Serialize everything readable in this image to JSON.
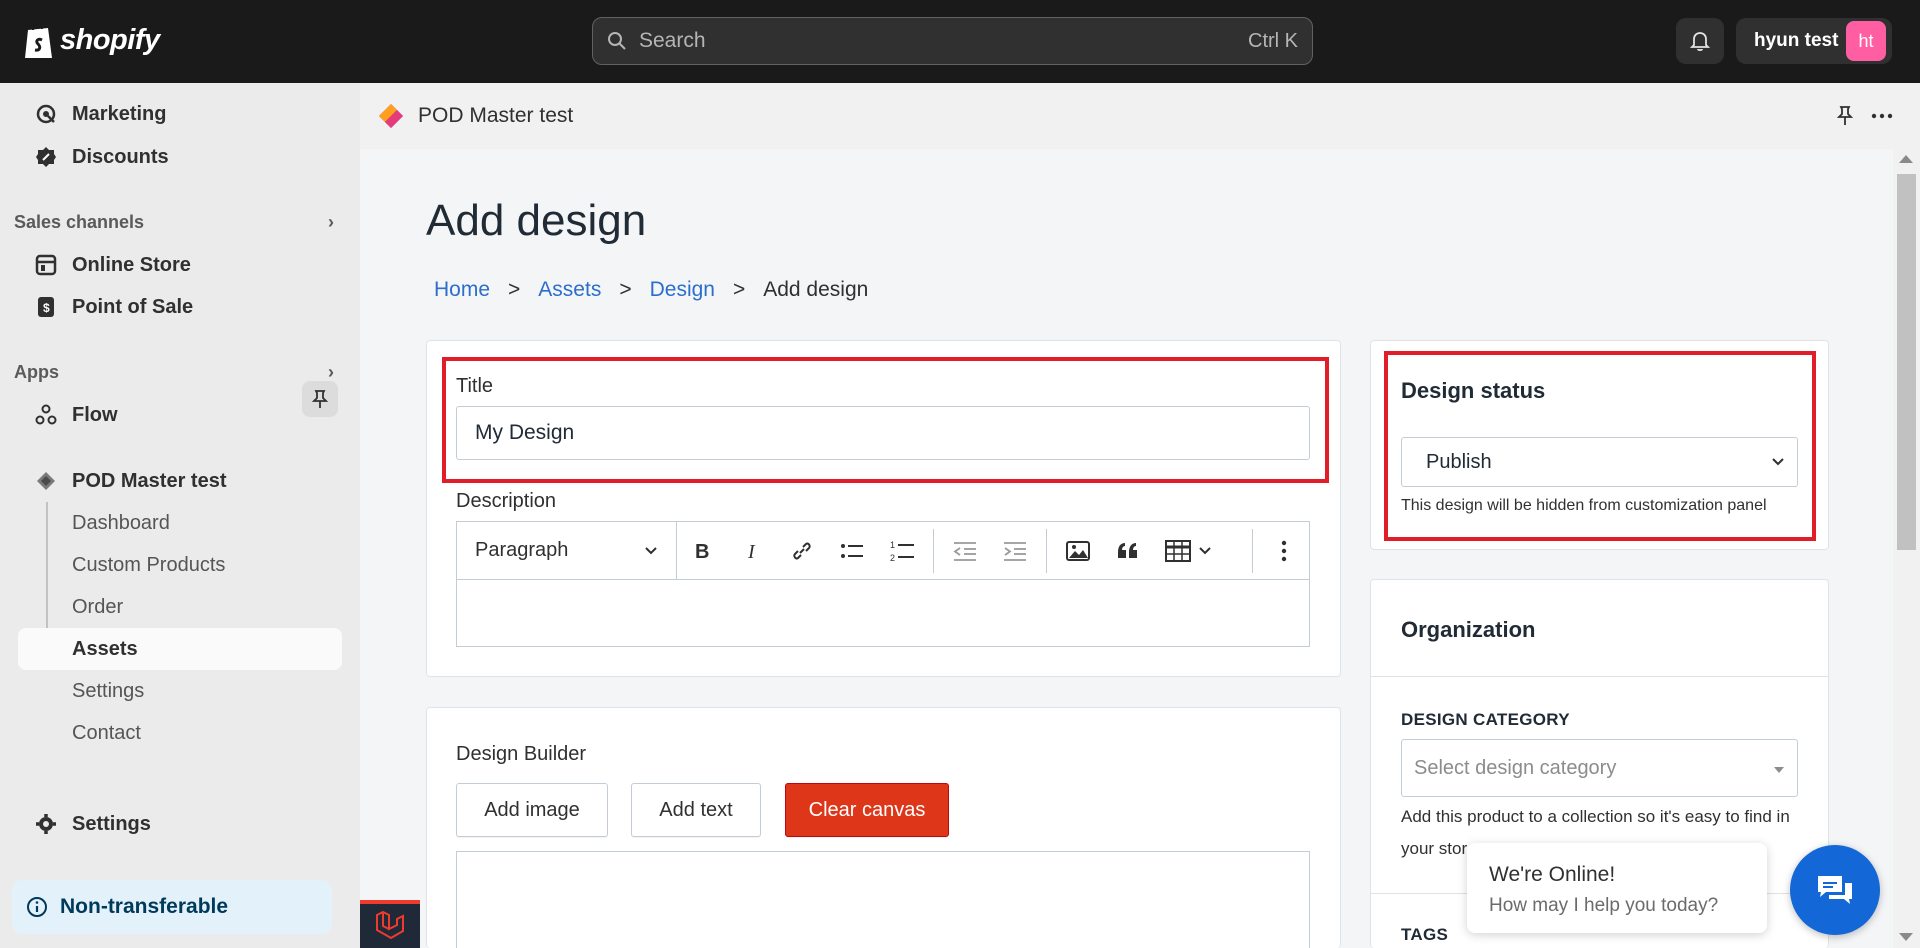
{
  "topbar": {
    "brand": "shopify",
    "search_placeholder": "Search",
    "search_shortcut": "Ctrl K",
    "user_name": "hyun test",
    "user_initials": "ht"
  },
  "sidebar": {
    "items_top": [
      {
        "label": "Marketing",
        "icon": "marketing-icon"
      },
      {
        "label": "Discounts",
        "icon": "discount-icon"
      }
    ],
    "sales_channels_heading": "Sales channels",
    "sales_channels": [
      {
        "label": "Online Store",
        "icon": "store-icon"
      },
      {
        "label": "Point of Sale",
        "icon": "pos-icon"
      }
    ],
    "apps_heading": "Apps",
    "apps": [
      {
        "label": "Flow",
        "icon": "flow-icon"
      },
      {
        "label": "POD Master test",
        "icon": "app-icon"
      }
    ],
    "app_sub_items": [
      "Dashboard",
      "Custom Products",
      "Order",
      "Assets",
      "Settings",
      "Contact"
    ],
    "active_sub_item": "Assets",
    "settings_label": "Settings",
    "non_transferable_label": "Non-transferable"
  },
  "app_header": {
    "title": "POD Master test"
  },
  "page": {
    "title": "Add design",
    "breadcrumb": {
      "home": "Home",
      "assets": "Assets",
      "design": "Design",
      "current": "Add design",
      "separator": ">"
    },
    "title_field": {
      "label": "Title",
      "value": "My Design"
    },
    "description": {
      "label": "Description",
      "format_select": "Paragraph"
    },
    "design_builder": {
      "label": "Design Builder",
      "add_image": "Add image",
      "add_text": "Add text",
      "clear_canvas": "Clear canvas"
    },
    "design_status": {
      "title": "Design status",
      "selected": "Publish",
      "help": "This design will be hidden from customization panel"
    },
    "organization": {
      "title": "Organization",
      "category_label": "DESIGN CATEGORY",
      "category_placeholder": "Select design category",
      "category_help_line1": "Add this product to a collection so it's easy to find in",
      "category_help_line2": "your stor",
      "tags_label": "TAGS"
    }
  },
  "chat": {
    "title": "We're Online!",
    "subtitle": "How may I help you today?"
  },
  "colors": {
    "highlight": "#e11d2a",
    "danger_button": "#de3618",
    "link": "#2c6ecb",
    "chat_button": "#1367d6"
  }
}
